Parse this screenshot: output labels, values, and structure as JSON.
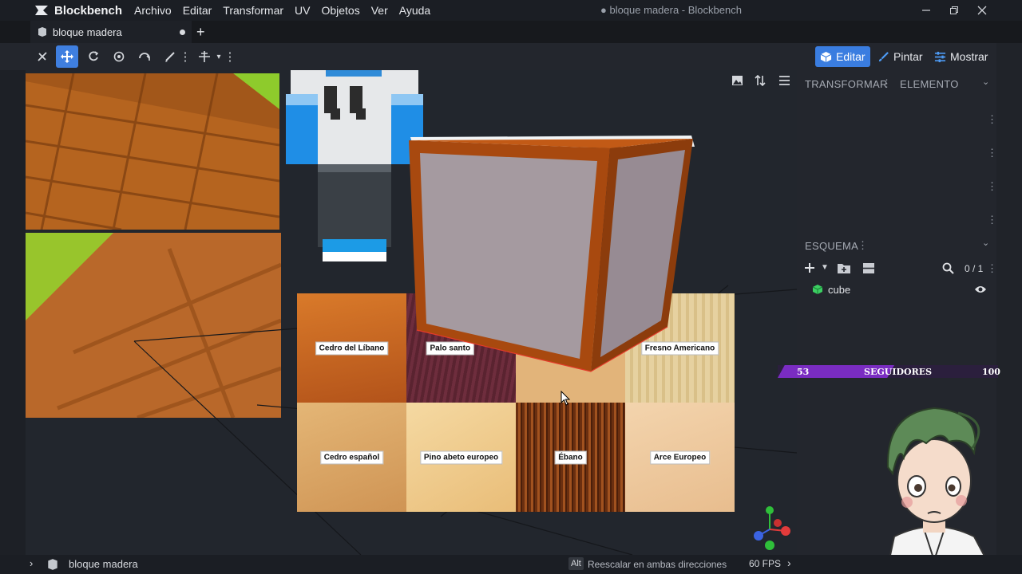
{
  "app": {
    "name": "Blockbench",
    "window_title": "● bloque madera - Blockbench"
  },
  "menu": [
    "Archivo",
    "Editar",
    "Transformar",
    "UV",
    "Objetos",
    "Ver",
    "Ayuda"
  ],
  "tabs": [
    {
      "label": "bloque madera"
    }
  ],
  "modes": {
    "edit": "Editar",
    "paint": "Pintar",
    "display": "Mostrar"
  },
  "panel": {
    "transform_tab": "TRANSFORMAR",
    "element_tab": "ELEMENTO",
    "outliner_title": "ESQUEMA",
    "outliner_count": "0 / 1",
    "items": [
      {
        "name": "cube"
      }
    ]
  },
  "wood_samples": [
    {
      "label": "Cedro del Líbano",
      "color": "#c0641e"
    },
    {
      "label": "Palo santo",
      "color": "#5a2330"
    },
    {
      "label": "",
      "color": "#e2b47a"
    },
    {
      "label": "Fresno Americano",
      "color": "#e4cf9c"
    },
    {
      "label": "Cedro español",
      "color": "#dca867"
    },
    {
      "label": "Pino abeto europeo",
      "color": "#f0cf92"
    },
    {
      "label": "Ébano",
      "color": "#6a2f10"
    },
    {
      "label": "Arce Europeo",
      "color": "#efc9a0"
    }
  ],
  "overlay": {
    "followers_current": "53",
    "followers_label": "SEGUIDORES",
    "followers_goal": "100"
  },
  "status": {
    "project": "bloque madera",
    "key_hint": "Alt",
    "hint_text": "Reescalar en ambas direcciones",
    "fps": "60 FPS"
  },
  "colors": {
    "accent": "#3a7de0",
    "follower_bar": "#7a2cc2",
    "cube_outline": "#a8490f",
    "cube_face": "#a69ba0"
  }
}
